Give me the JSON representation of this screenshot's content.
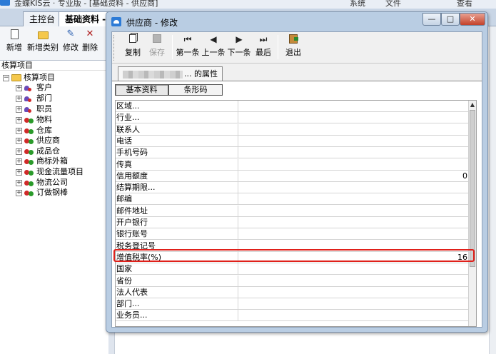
{
  "main_window": {
    "title": "金蝶KIS云 · 专业版 - [基础资料 - 供应商]",
    "menus": [
      "系统",
      "文件",
      "查看"
    ],
    "tabs": [
      "主控台",
      "基础资料 -"
    ],
    "toolbar": [
      "新增",
      "新增类别",
      "修改",
      "删除"
    ],
    "left_panel_title": "核算项目",
    "tree": {
      "root": "核算项目",
      "items": [
        "客户",
        "部门",
        "职员",
        "物料",
        "仓库",
        "供应商",
        "成品仓",
        "商标外箱",
        "现金流量项目",
        "物流公司",
        "订做钢棒"
      ]
    }
  },
  "dialog": {
    "title": "供应商 - 修改",
    "window_buttons": {
      "minimize": "—",
      "maximize": "□",
      "close": "✕"
    },
    "toolbar": [
      {
        "label": "复制",
        "icon": "copy-icon",
        "enabled": true
      },
      {
        "label": "保存",
        "icon": "save-icon",
        "enabled": false
      },
      {
        "label": "第一条",
        "icon": "first-record-icon",
        "enabled": true
      },
      {
        "label": "上一条",
        "icon": "previous-record-icon",
        "enabled": true
      },
      {
        "label": "下一条",
        "icon": "next-record-icon",
        "enabled": true
      },
      {
        "label": "最后",
        "icon": "last-record-icon",
        "enabled": true
      },
      {
        "label": "退出",
        "icon": "exit-icon",
        "enabled": true
      }
    ],
    "property_tab_suffix": "... 的属性",
    "sub_tabs": [
      "基本资料",
      "条形码"
    ],
    "fields": [
      {
        "name": "区域...",
        "value": ""
      },
      {
        "name": "行业...",
        "value": ""
      },
      {
        "name": "联系人",
        "value": ""
      },
      {
        "name": "电话",
        "value": ""
      },
      {
        "name": "手机号码",
        "value": ""
      },
      {
        "name": "传真",
        "value": ""
      },
      {
        "name": "信用额度",
        "value": "0"
      },
      {
        "name": "结算期限...",
        "value": ""
      },
      {
        "name": "邮编",
        "value": ""
      },
      {
        "name": "邮件地址",
        "value": ""
      },
      {
        "name": "开户银行",
        "value": ""
      },
      {
        "name": "银行账号",
        "value": ""
      },
      {
        "name": "税务登记号",
        "value": ""
      },
      {
        "name": "增值税率(%)",
        "value": "16"
      },
      {
        "name": "国家",
        "value": ""
      },
      {
        "name": "省份",
        "value": ""
      },
      {
        "name": "法人代表",
        "value": ""
      },
      {
        "name": "部门...",
        "value": ""
      },
      {
        "name": "业务员...",
        "value": ""
      }
    ],
    "highlighted_field": "增值税率(%)",
    "colors": {
      "highlight": "#e0201a",
      "dialog_frame": "#b9cde3"
    }
  }
}
